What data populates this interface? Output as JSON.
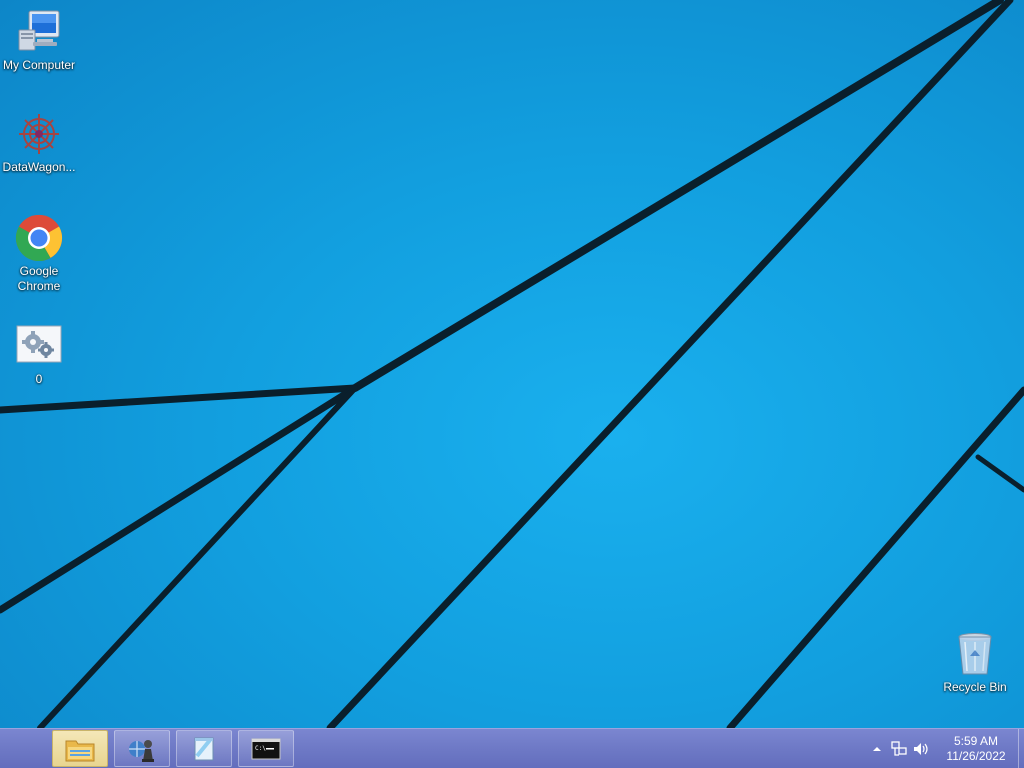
{
  "desktop": {
    "icons": [
      {
        "label": "My Computer",
        "icon": "computer-icon"
      },
      {
        "label": "DataWagon...",
        "icon": "datawagon-icon"
      },
      {
        "label": "Google Chrome",
        "icon": "chrome-icon"
      },
      {
        "label": "0",
        "icon": "settings-shortcut-icon"
      },
      {
        "label": "Recycle Bin",
        "icon": "recycle-bin-icon"
      }
    ]
  },
  "taskbar": {
    "buttons": [
      {
        "icon": "file-explorer-icon",
        "active": true
      },
      {
        "icon": "network-tool-icon",
        "active": false
      },
      {
        "icon": "notepad-icon",
        "active": false
      },
      {
        "icon": "command-prompt-icon",
        "active": false
      }
    ],
    "tray": {
      "overflow_icon": "chevron-up-icon",
      "network_icon": "network-icon",
      "volume_icon": "speaker-icon",
      "time": "5:59 AM",
      "date": "11/26/2022"
    }
  },
  "colors": {
    "wallpaper": "#129fdf",
    "taskbar": "#6e79c6",
    "active_button": "#e8d590"
  }
}
